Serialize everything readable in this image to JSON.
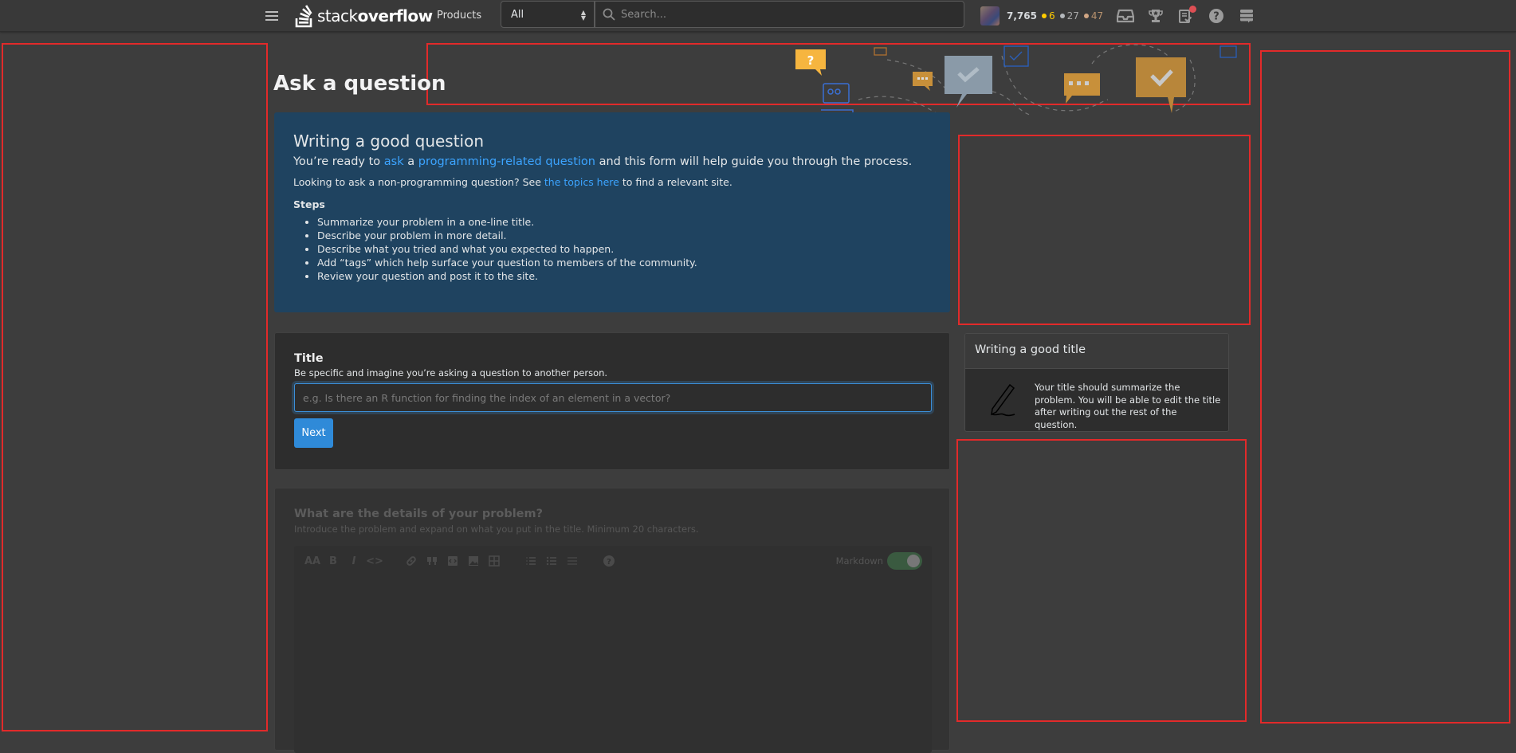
{
  "topbar": {
    "brand_light": "stack",
    "brand_bold": "overflow",
    "products_label": "Products",
    "scope_value": "All",
    "search_placeholder": "Search...",
    "user": {
      "reputation": "7,765",
      "gold_badges": "6",
      "silver_badges": "27",
      "bronze_badges": "47"
    },
    "icons": [
      "menu-icon",
      "inbox-icon",
      "achievements-icon",
      "review-queue-icon",
      "help-icon",
      "site-switcher-icon"
    ],
    "colors": {
      "gold": "#ffcc00",
      "silver": "#b4b8bc",
      "bronze": "#d1a684",
      "notification": "#de4f54"
    }
  },
  "page": {
    "title": "Ask a question"
  },
  "notice": {
    "heading": "Writing a good question",
    "lead_prefix": "You’re ready to ",
    "lead_link1": "ask",
    "lead_mid": " a ",
    "lead_link2": "programming-related question",
    "lead_suffix": " and this form will help guide you through the process.",
    "sub_prefix": "Looking to ask a non-programming question? See ",
    "sub_link": "the topics here",
    "sub_suffix": " to find a relevant site.",
    "steps_heading": "Steps",
    "steps": [
      "Summarize your problem in a one-line title.",
      "Describe your problem in more detail.",
      "Describe what you tried and what you expected to happen.",
      "Add “tags” which help surface your question to members of the community.",
      "Review your question and post it to the site."
    ],
    "colors": {
      "background": "#1f4360",
      "link": "#3ca4ff"
    }
  },
  "title_section": {
    "label": "Title",
    "description": "Be specific and imagine you’re asking a question to another person.",
    "input_value": "",
    "input_placeholder": "e.g. Is there an R function for finding the index of an element in a vector?",
    "next_label": "Next",
    "colors": {
      "button": "#2f8ad8",
      "focus": "#3b8fd9"
    }
  },
  "details_section": {
    "label": "What are the details of your problem?",
    "description": "Introduce the problem and expand on what you put in the title. Minimum 20 characters.",
    "toolbar": {
      "heading": "AA",
      "bold": "B",
      "italic": "I",
      "code": "<>",
      "help": "?"
    },
    "markdown_label": "Markdown",
    "markdown_enabled": true
  },
  "help_card": {
    "title": "Writing a good title",
    "body": "Your title should summarize the problem. You will be able to edit the title after writing out the rest of the question."
  }
}
